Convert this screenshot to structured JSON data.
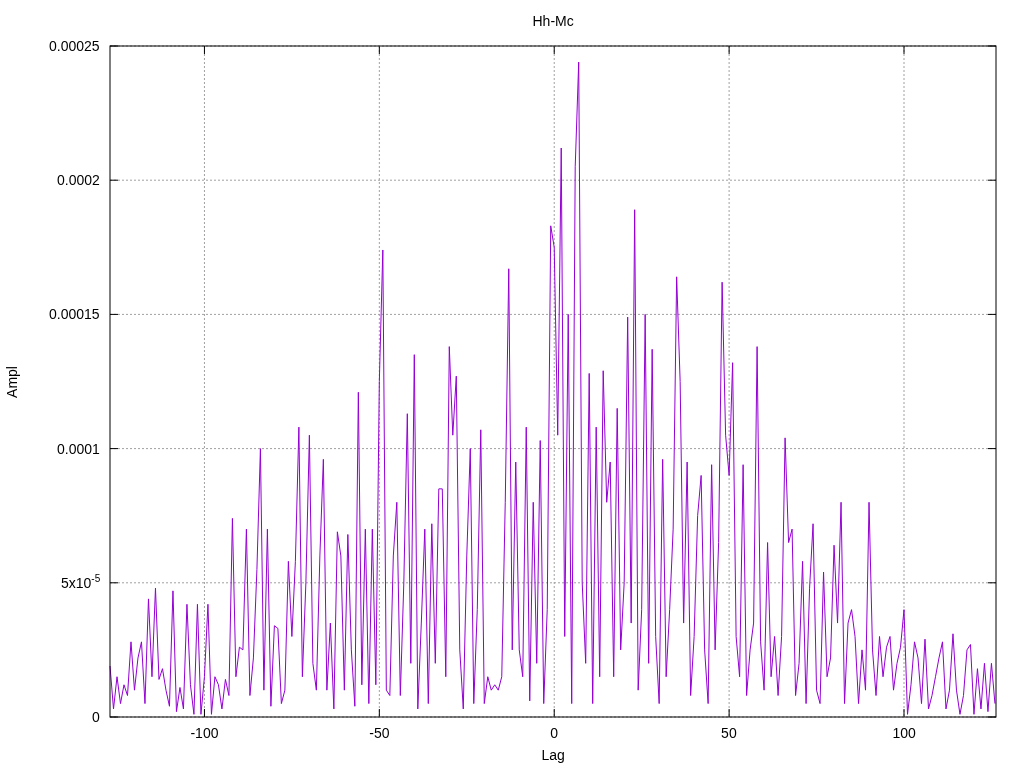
{
  "chart_data": {
    "type": "line",
    "grid": true,
    "title": "Hh-Mc",
    "xlabel": "Lag",
    "ylabel": "Ampl",
    "xlim": [
      -127,
      126.3
    ],
    "ylim": [
      0,
      0.00025
    ],
    "xticks": [
      -100,
      -50,
      0,
      50,
      100
    ],
    "yticks": [
      0,
      {
        "value": 5e-05,
        "label": "5x10$^{-5}$"
      },
      0.0001,
      0.00015,
      0.0002,
      0.00025
    ],
    "x": [
      -127,
      -126,
      -125,
      -124,
      -123,
      -122,
      -121,
      -120,
      -119,
      -118,
      -117,
      -116,
      -115,
      -114,
      -113,
      -112,
      -111,
      -110,
      -109,
      -108,
      -107,
      -106,
      -105,
      -104,
      -103,
      -102,
      -101,
      -100,
      -99,
      -98,
      -97,
      -96,
      -95,
      -94,
      -93,
      -92,
      -91,
      -90,
      -89,
      -88,
      -87,
      -86,
      -85,
      -84,
      -83,
      -82,
      -81,
      -80,
      -79,
      -78,
      -77,
      -76,
      -75,
      -74,
      -73,
      -72,
      -71,
      -70,
      -69,
      -68,
      -67,
      -66,
      -65,
      -64,
      -63,
      -62,
      -61,
      -60,
      -59,
      -58,
      -57,
      -56,
      -55,
      -54,
      -53,
      -52,
      -51,
      -50,
      -49,
      -48,
      -47,
      -46,
      -45,
      -44,
      -43,
      -42,
      -41,
      -40,
      -39,
      -38,
      -37,
      -36,
      -35,
      -34,
      -33,
      -32,
      -31,
      -30,
      -29,
      -28,
      -27,
      -26,
      -25,
      -24,
      -23,
      -22,
      -21,
      -20,
      -19,
      -18,
      -17,
      -16,
      -15,
      -14,
      -13,
      -12,
      -11,
      -10,
      -9,
      -8,
      -7,
      -6,
      -5,
      -4,
      -3,
      -2,
      -1,
      0,
      1,
      2,
      3,
      4,
      5,
      6,
      7,
      8,
      9,
      10,
      11,
      12,
      13,
      14,
      15,
      16,
      17,
      18,
      19,
      20,
      21,
      22,
      23,
      24,
      25,
      26,
      27,
      28,
      29,
      30,
      31,
      32,
      33,
      34,
      35,
      36,
      37,
      38,
      39,
      40,
      41,
      42,
      43,
      44,
      45,
      46,
      47,
      48,
      49,
      50,
      51,
      52,
      53,
      54,
      55,
      56,
      57,
      58,
      59,
      60,
      61,
      62,
      63,
      64,
      65,
      66,
      67,
      68,
      69,
      70,
      71,
      72,
      73,
      74,
      75,
      76,
      77,
      78,
      79,
      80,
      81,
      82,
      83,
      84,
      85,
      86,
      87,
      88,
      89,
      90,
      91,
      92,
      93,
      94,
      95,
      96,
      97,
      98,
      99,
      100,
      101,
      102,
      103,
      104,
      105,
      106,
      107,
      108,
      109,
      110,
      111,
      112,
      113,
      114,
      115,
      116,
      117,
      118,
      119,
      120,
      121,
      122,
      123,
      124,
      125,
      126
    ],
    "series": [
      {
        "color": "#9400d3",
        "values": [
          1.9e-05,
          3e-06,
          1.5e-05,
          5e-06,
          1.2e-05,
          8e-06,
          2.8e-05,
          1e-05,
          2.2e-05,
          2.8e-05,
          5e-06,
          4.4e-05,
          1.5e-05,
          4.8e-05,
          1.4e-05,
          1.8e-05,
          1e-05,
          4e-06,
          4.7e-05,
          2e-06,
          1.1e-05,
          3e-06,
          4.2e-05,
          1.2e-05,
          1e-06,
          4.2e-05,
          1e-06,
          1.5e-05,
          4.2e-05,
          1e-06,
          1.5e-05,
          1.2e-05,
          3e-06,
          1.4e-05,
          8e-06,
          7.4e-05,
          1.5e-05,
          2.6e-05,
          2.5e-05,
          7e-05,
          8e-06,
          2.2e-05,
          5.5e-05,
          0.0001,
          1e-05,
          7e-05,
          4e-06,
          3.4e-05,
          3.3e-05,
          5e-06,
          1e-05,
          5.8e-05,
          3e-05,
          5.8e-05,
          0.000108,
          1.5e-05,
          5e-05,
          0.000105,
          2e-05,
          1e-05,
          6e-05,
          9.6e-05,
          1e-05,
          3.5e-05,
          3e-06,
          6.9e-05,
          6e-05,
          1e-05,
          6.8e-05,
          2.5e-05,
          4e-06,
          0.000121,
          1.2e-05,
          7e-05,
          5e-06,
          7e-05,
          1.2e-05,
          0.000125,
          0.000174,
          1e-05,
          8e-06,
          6e-05,
          8e-05,
          8e-06,
          5e-05,
          0.000113,
          2e-05,
          0.000135,
          3e-06,
          3.5e-05,
          7e-05,
          5e-06,
          7.2e-05,
          2e-05,
          8.5e-05,
          8.5e-05,
          1.5e-05,
          0.000138,
          0.000105,
          0.000127,
          2.5e-05,
          3e-06,
          6e-05,
          0.0001,
          5e-06,
          4e-05,
          0.000107,
          5e-06,
          1.5e-05,
          1e-05,
          1.2e-05,
          1e-05,
          1.5e-05,
          8e-05,
          0.000167,
          2.5e-05,
          9.5e-05,
          2.5e-05,
          1.5e-05,
          0.000108,
          6e-06,
          8e-05,
          2e-05,
          0.000103,
          5e-06,
          4e-05,
          0.000183,
          0.000175,
          0.000105,
          0.000212,
          3e-05,
          0.00015,
          5e-06,
          0.000205,
          0.000244,
          5e-05,
          2e-05,
          0.000128,
          5e-06,
          0.000108,
          1.5e-05,
          0.000129,
          8e-05,
          9.5e-05,
          1.5e-05,
          0.000115,
          2.5e-05,
          5e-05,
          0.000149,
          3.5e-05,
          0.000189,
          1e-05,
          4e-05,
          0.00015,
          2e-05,
          0.000137,
          3e-05,
          5e-06,
          9.6e-05,
          1.5e-05,
          4e-05,
          7e-05,
          0.000164,
          0.000125,
          3.5e-05,
          9.5e-05,
          8e-06,
          3e-05,
          7.5e-05,
          9e-05,
          2.5e-05,
          5e-06,
          9.4e-05,
          2.5e-05,
          6.5e-05,
          0.000162,
          0.000105,
          9e-05,
          0.000132,
          3e-05,
          1.5e-05,
          9.4e-05,
          8e-06,
          2.5e-05,
          3.5e-05,
          0.000138,
          2.8e-05,
          1e-05,
          6.5e-05,
          1.5e-05,
          3e-05,
          8e-06,
          3e-05,
          0.000104,
          6.5e-05,
          7e-05,
          8e-06,
          2e-05,
          5.8e-05,
          5e-06,
          4.8e-05,
          7.2e-05,
          1e-05,
          5e-06,
          5.4e-05,
          1.5e-05,
          2.2e-05,
          6.4e-05,
          3.5e-05,
          8e-05,
          5e-06,
          3.5e-05,
          4e-05,
          3e-05,
          5e-06,
          2.5e-05,
          1e-05,
          8e-05,
          2.5e-05,
          8e-06,
          3e-05,
          1.5e-05,
          2.6e-05,
          3e-05,
          1e-05,
          2e-05,
          2.6e-05,
          4e-05,
          1e-06,
          1.2e-05,
          2.8e-05,
          2.2e-05,
          5e-06,
          2.9e-05,
          3e-06,
          8e-06,
          1.5e-05,
          2.2e-05,
          2.8e-05,
          3e-06,
          1e-05,
          3.1e-05,
          1e-05,
          1e-06,
          8e-06,
          2.5e-05,
          2.7e-05,
          1e-06,
          1.8e-05,
          3e-06,
          2e-05,
          2e-06,
          2e-05,
          5e-06
        ]
      }
    ]
  }
}
